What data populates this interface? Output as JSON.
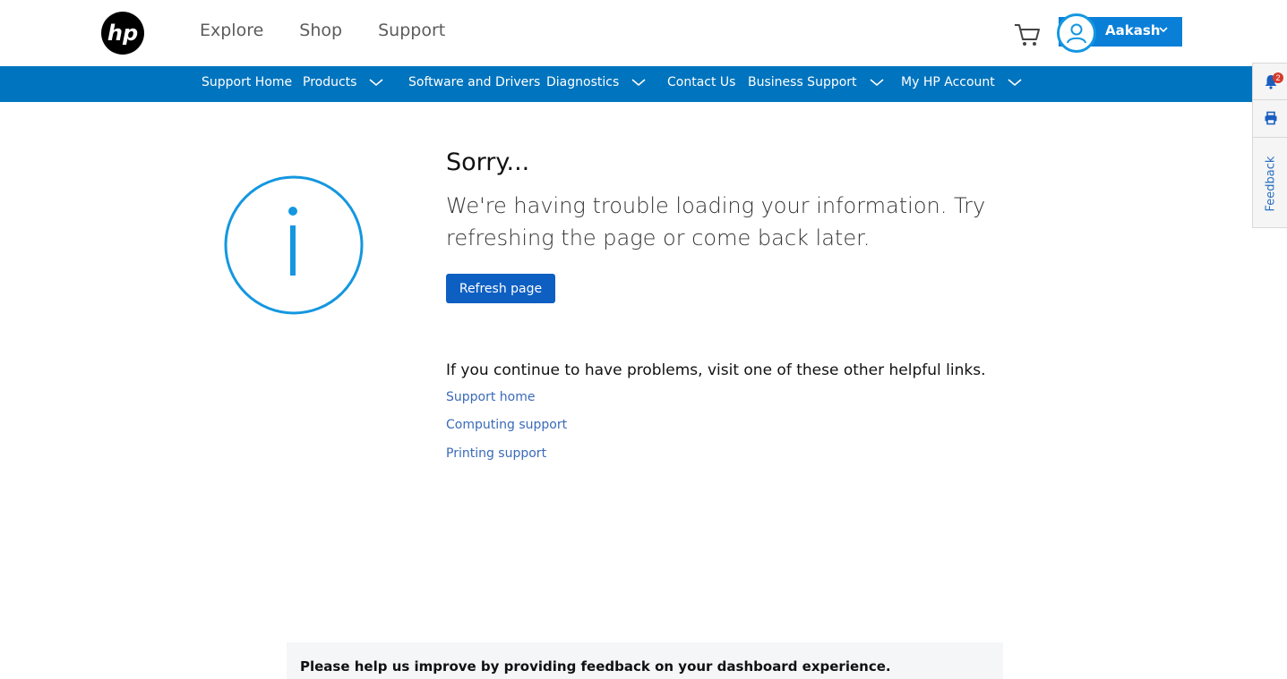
{
  "header": {
    "nav": [
      "Explore",
      "Shop",
      "Support"
    ],
    "account_name": "Aakash"
  },
  "subnav": {
    "items": [
      "Support Home",
      "Products",
      "Software and Drivers",
      "Diagnostics",
      "Contact Us",
      "Business Support",
      "My HP Account"
    ]
  },
  "siderail": {
    "notification_count": "2",
    "feedback_label": "Feedback"
  },
  "main": {
    "title": "Sorry...",
    "message": "We're having trouble loading your information. Try refreshing the page or come back later.",
    "refresh_label": "Refresh page",
    "help_heading": "If you continue to have problems, visit one of these other helpful links.",
    "links": [
      "Support home",
      "Computing support",
      "Printing support"
    ]
  },
  "feedback_banner": {
    "text": "Please help us improve by providing feedback on your dashboard experience."
  },
  "colors": {
    "nav_blue": "#0074be",
    "button_blue": "#0e5fc2",
    "info_blue": "#1497e0"
  }
}
